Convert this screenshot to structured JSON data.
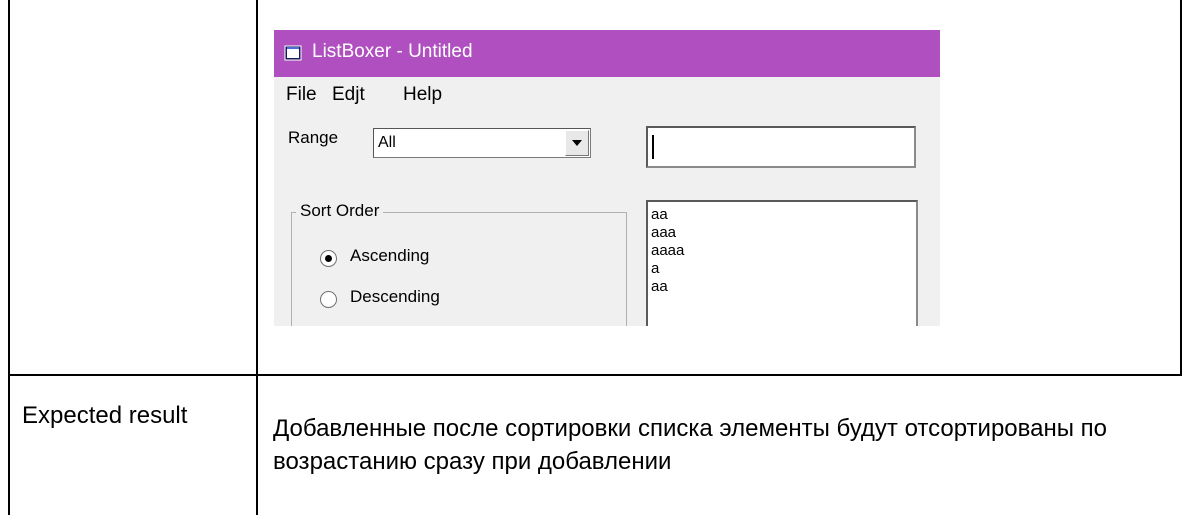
{
  "document": {
    "expected_result_label": "Expected result",
    "expected_result_text": "Добавленные после сортировки списка элементы будут отсортированы по возрастанию сразу при добавлении"
  },
  "window": {
    "title": "ListBoxer - Untitled",
    "icon": "app-window-icon",
    "titlebar_color": "#b050c0"
  },
  "menu": {
    "file": "File",
    "edit": "Edjt",
    "help": "Help"
  },
  "range": {
    "label": "Range",
    "selected": "All"
  },
  "input": {
    "value": ""
  },
  "sort_order": {
    "legend": "Sort Order",
    "ascending": "Ascending",
    "descending": "Descending",
    "selected": "Ascending"
  },
  "list": {
    "items": [
      "aa",
      "aaa",
      "aaaa",
      "a",
      "aa"
    ]
  }
}
